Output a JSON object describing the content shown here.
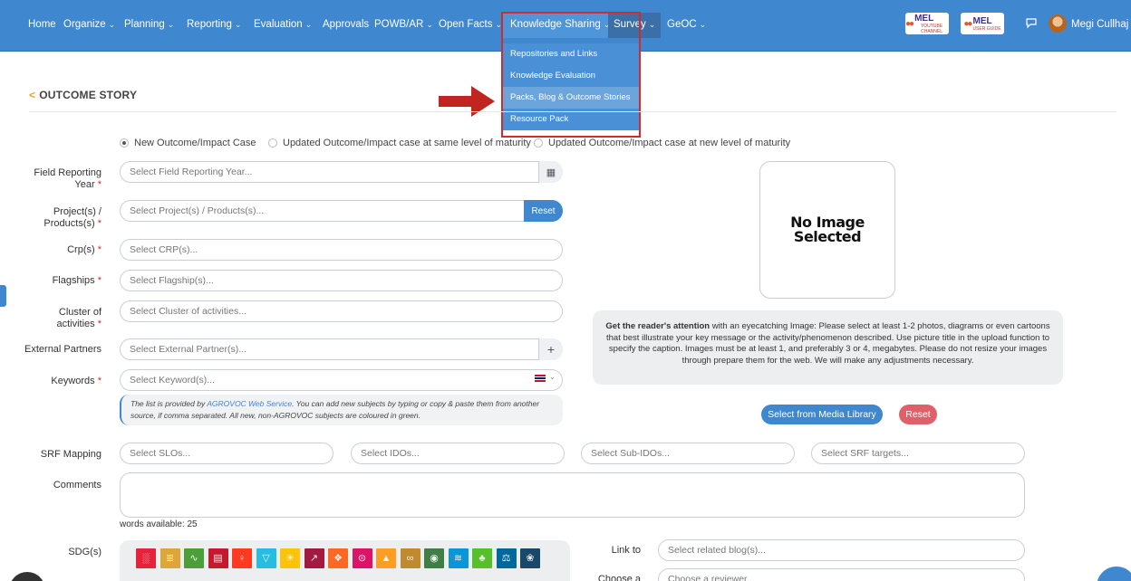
{
  "nav": {
    "home": "Home",
    "organize": "Organize",
    "planning": "Planning",
    "reporting": "Reporting",
    "evaluation": "Evaluation",
    "approvals": "Approvals",
    "powb": "POWB/AR",
    "open_facts": "Open Facts",
    "knowledge_sharing": "Knowledge Sharing",
    "survey": "Survey",
    "geoc": "GeOC",
    "user_name": "Megi Cullhaj",
    "mel_1": "MEL",
    "mel_1_sub": "YOUTUBE CHANNEL",
    "mel_2": "MEL",
    "mel_2_sub": "USER GUIDE"
  },
  "dropdown": {
    "items": [
      "Repositories and Links",
      "Knowledge Evaluation",
      "Packs, Blog & Outcome Stories",
      "Resource Pack"
    ],
    "active_index": 2
  },
  "card": {
    "title": "OUTCOME STORY"
  },
  "radios": {
    "options": [
      "New Outcome/Impact Case",
      "Updated Outcome/Impact case at same level of maturity",
      "Updated Outcome/Impact case at new level of maturity"
    ],
    "selected_index": 0
  },
  "fields": {
    "field_year": {
      "label_line1": "Field Reporting",
      "label_line2": "Year",
      "placeholder": "Select Field Reporting Year..."
    },
    "projects": {
      "label_line1": "Project(s) /",
      "label_line2": "Products(s)",
      "placeholder": "Select Project(s) / Products(s)...",
      "button": "Reset"
    },
    "crp": {
      "label": "Crp(s)",
      "placeholder": "Select CRP(s)..."
    },
    "flagships": {
      "label": "Flagships",
      "placeholder": "Select Flagship(s)..."
    },
    "cluster": {
      "label_line1": "Cluster of",
      "label_line2": "activities",
      "placeholder": "Select Cluster of activities..."
    },
    "partners": {
      "label": "External Partners",
      "placeholder": "Select External Partner(s)..."
    },
    "keywords": {
      "label": "Keywords",
      "placeholder": "Select Keyword(s)..."
    },
    "srf": {
      "label": "SRF Mapping",
      "slo": "Select SLOs...",
      "ido": "Select IDOs...",
      "subido": "Select Sub-IDOs...",
      "targets": "Select SRF targets..."
    },
    "comments": {
      "label": "Comments",
      "words_available": "words available: 25"
    },
    "sdg": {
      "label": "SDG(s)"
    },
    "link_to": {
      "label": "Link to",
      "placeholder": "Select related blog(s)..."
    },
    "choose": {
      "label": "Choose a",
      "placeholder": "Choose a reviewer..."
    }
  },
  "keywords_info": {
    "prefix": "The list is provided by",
    "link": "AGROVOC Web Service",
    "suffix": ". You can add new subjects by typing or copy & paste them from another source, if comma separated. All new, non-AGROVOC subjects are coloured in green."
  },
  "image": {
    "placeholder_line1": "No Image",
    "placeholder_line2": "Selected",
    "attention_bold": "Get the reader's attention",
    "attention_text": " with an eyecatching Image: Please select at least 1-2 photos, diagrams or even cartoons that best illustrate your key message or the activity/phenomenon described. Use picture title in the upload function to specify the caption. Images must be at least 1, and preferably 3 or 4, megabytes. Please do not resize your images through prepare them for the web. We will make any adjustments necessary.",
    "select_button": "Select from Media Library",
    "reset_button": "Reset"
  },
  "sdg_colors": [
    "#e5243b",
    "#dda63a",
    "#4c9f38",
    "#c5192d",
    "#ff3a21",
    "#26bde2",
    "#fcc30b",
    "#a21942",
    "#fd6925",
    "#dd1367",
    "#fd9d24",
    "#bf8b2e",
    "#3f7e44",
    "#0a97d9",
    "#56c02b",
    "#00689d",
    "#19486a"
  ]
}
